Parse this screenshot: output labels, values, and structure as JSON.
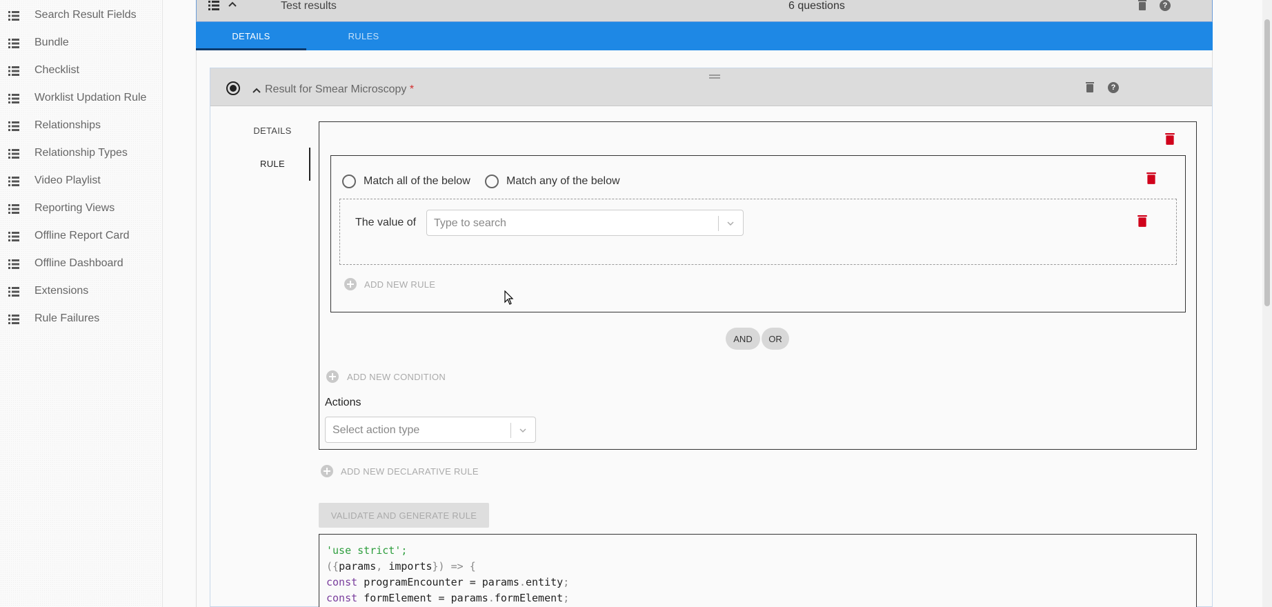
{
  "sidebar": {
    "items": [
      {
        "label": "Search Result Fields"
      },
      {
        "label": "Bundle"
      },
      {
        "label": "Checklist"
      },
      {
        "label": "Worklist Updation Rule"
      },
      {
        "label": "Relationships"
      },
      {
        "label": "Relationship Types"
      },
      {
        "label": "Video Playlist"
      },
      {
        "label": "Reporting Views"
      },
      {
        "label": "Offline Report Card"
      },
      {
        "label": "Offline Dashboard"
      },
      {
        "label": "Extensions"
      },
      {
        "label": "Rule Failures"
      }
    ]
  },
  "group": {
    "title": "Test results",
    "question_count": "6 questions",
    "tabs": {
      "details": "DETAILS",
      "rules": "RULES"
    }
  },
  "question": {
    "title": "Result for Smear Microscopy",
    "required_mark": "*",
    "tabs": {
      "details": "DETAILS",
      "rule": "RULE"
    }
  },
  "rule": {
    "match_all_label": "Match all of the below",
    "match_any_label": "Match any of the below",
    "value_of_label": "The value of",
    "value_placeholder": "Type to search",
    "add_new_rule": "ADD NEW RULE",
    "and_label": "AND",
    "or_label": "OR",
    "add_new_condition": "ADD NEW CONDITION",
    "actions_label": "Actions",
    "action_placeholder": "Select action type",
    "add_new_declarative_rule": "ADD NEW DECLARATIVE RULE",
    "validate_button": "VALIDATE AND GENERATE RULE"
  },
  "code": {
    "line1": "'use strict';",
    "line2_a": "({",
    "line2_b": "params",
    "line2_c": ", ",
    "line2_d": "imports",
    "line2_e": "}) => {",
    "line3_a": "const ",
    "line3_b": "programEncounter = params",
    "line3_c": ".",
    "line3_d": "entity",
    "line3_e": ";",
    "line4_a": "const ",
    "line4_b": "formElement = params",
    "line4_c": ".",
    "line4_d": "formElement",
    "line4_e": ";"
  },
  "colors": {
    "tab_bar": "#1e88e5",
    "delete_red": "#d0021b",
    "required": "#d32f2f"
  },
  "icons": {
    "sidebar": "list-icon",
    "delete": "trash-icon",
    "help": "help-icon"
  }
}
